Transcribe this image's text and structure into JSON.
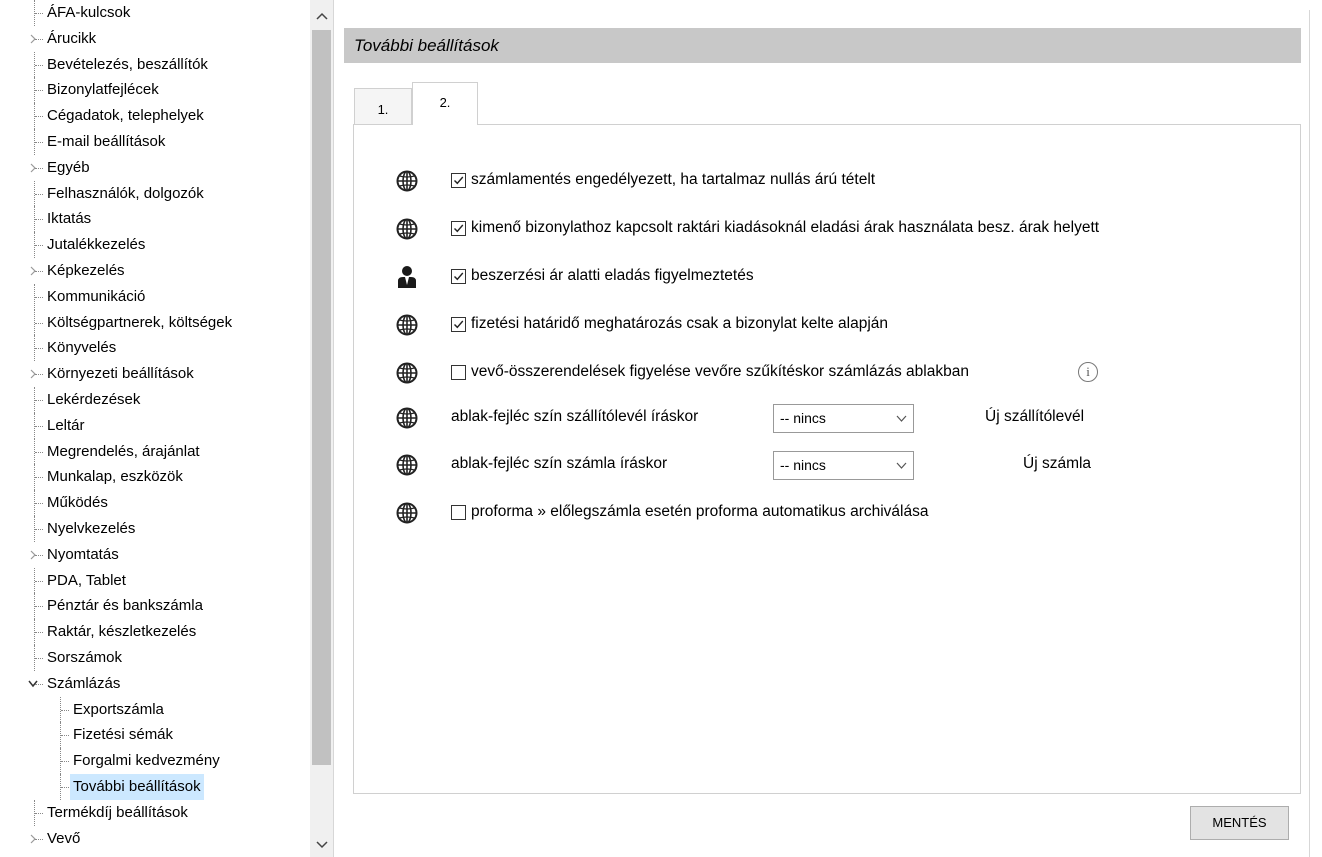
{
  "tree": {
    "items": [
      {
        "label": "ÁFA-kulcsok",
        "expandable": false
      },
      {
        "label": "Árucikk",
        "expandable": true
      },
      {
        "label": "Bevételezés, beszállítók",
        "expandable": false
      },
      {
        "label": "Bizonylatfejlécek",
        "expandable": false
      },
      {
        "label": "Cégadatok, telephelyek",
        "expandable": false
      },
      {
        "label": "E-mail beállítások",
        "expandable": false
      },
      {
        "label": "Egyéb",
        "expandable": true
      },
      {
        "label": "Felhasználók, dolgozók",
        "expandable": false
      },
      {
        "label": "Iktatás",
        "expandable": false
      },
      {
        "label": "Jutalékkezelés",
        "expandable": false
      },
      {
        "label": "Képkezelés",
        "expandable": true
      },
      {
        "label": "Kommunikáció",
        "expandable": false
      },
      {
        "label": "Költségpartnerek, költségek",
        "expandable": false
      },
      {
        "label": "Könyvelés",
        "expandable": false
      },
      {
        "label": "Környezeti beállítások",
        "expandable": true
      },
      {
        "label": "Lekérdezések",
        "expandable": false
      },
      {
        "label": "Leltár",
        "expandable": false
      },
      {
        "label": "Megrendelés, árajánlat",
        "expandable": false
      },
      {
        "label": "Munkalap, eszközök",
        "expandable": false
      },
      {
        "label": "Működés",
        "expandable": false
      },
      {
        "label": "Nyelvkezelés",
        "expandable": false
      },
      {
        "label": "Nyomtatás",
        "expandable": true
      },
      {
        "label": "PDA, Tablet",
        "expandable": false
      },
      {
        "label": "Pénztár és bankszámla",
        "expandable": false
      },
      {
        "label": "Raktár, készletkezelés",
        "expandable": false
      },
      {
        "label": "Sorszámok",
        "expandable": false
      },
      {
        "label": "Számlázás",
        "expandable": true,
        "expanded": true
      },
      {
        "label": "Exportszámla",
        "child": true
      },
      {
        "label": "Fizetési sémák",
        "child": true
      },
      {
        "label": "Forgalmi kedvezmény",
        "child": true
      },
      {
        "label": "További beállítások",
        "child": true,
        "selected": true
      },
      {
        "label": "Termékdíj beállítások",
        "expandable": false
      },
      {
        "label": "Vevő",
        "expandable": true
      }
    ]
  },
  "main": {
    "section_title": "További beállítások",
    "tabs": [
      {
        "label": "1."
      },
      {
        "label": "2.",
        "active": true
      }
    ],
    "settings": [
      {
        "icon": "globe-icon",
        "checked": true,
        "label": "számlamentés engedélyezett, ha tartalmaz nullás árú tételt"
      },
      {
        "icon": "globe-icon",
        "checked": true,
        "label": "kimenő bizonylathoz kapcsolt raktári kiadásoknál eladási árak használata besz. árak helyett"
      },
      {
        "icon": "user-icon",
        "checked": true,
        "label": "beszerzési ár alatti eladás figyelmeztetés"
      },
      {
        "icon": "globe-icon",
        "checked": true,
        "label": "fizetési határidő meghatározás csak a bizonylat kelte alapján"
      },
      {
        "icon": "globe-icon",
        "checked": false,
        "label": "vevő-összerendelések figyelése vevőre szűkítéskor számlázás ablakban",
        "info_icon": "i"
      },
      {
        "icon": "globe-icon",
        "label": "ablak-fejléc szín szállítólevél íráskor",
        "select_value": "-- nincs",
        "side_label": "Új szállítólevél"
      },
      {
        "icon": "globe-icon",
        "label": "ablak-fejléc szín számla íráskor",
        "select_value": "-- nincs",
        "side_label": "Új számla"
      },
      {
        "icon": "globe-icon",
        "checked": false,
        "label": "proforma » előlegszámla esetén proforma automatikus archiválása"
      }
    ],
    "save_label": "MENTÉS"
  },
  "scrollbar": {
    "up_icon": "⌃",
    "down_icon": "⌄"
  }
}
